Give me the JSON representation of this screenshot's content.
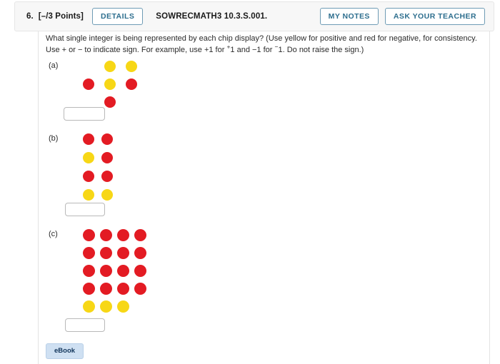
{
  "header": {
    "question_number": "6.",
    "points": "[–/3 Points]",
    "details_label": "DETAILS",
    "title": "SOWRECMATH3 10.3.S.001.",
    "my_notes_label": "MY NOTES",
    "ask_teacher_label": "ASK YOUR TEACHER"
  },
  "prompt": {
    "line1_a": "What single integer is being represented by each chip display? (Use yellow for positive and red for negative, for consistency. Use ",
    "line2_a": "+ or − to indicate sign. For example, use +1 for ",
    "sup1": "+",
    "line2_b": "1 and −1 for ",
    "sup2": "−",
    "line2_c": "1. Do not raise the sign.)"
  },
  "colors": {
    "yellow_chip": "#f7d716",
    "red_chip": "#e31b23",
    "accent": "#2d6e8e",
    "ebook_bg": "#cfe0f2"
  },
  "parts": [
    {
      "label": "(a)",
      "answer_value": "",
      "answer_placeholder": "",
      "rows": [
        [
          "none",
          "yellow",
          "yellow",
          "none"
        ],
        [
          "red",
          "yellow",
          "red",
          "none"
        ],
        [
          "none",
          "red",
          "none",
          "none"
        ]
      ]
    },
    {
      "label": "(b)",
      "answer_value": "",
      "answer_placeholder": "",
      "rows": [
        [
          "red",
          "red"
        ],
        [
          "yellow",
          "red"
        ],
        [
          "red",
          "red"
        ],
        [
          "yellow",
          "yellow"
        ]
      ]
    },
    {
      "label": "(c)",
      "answer_value": "",
      "answer_placeholder": "",
      "rows": [
        [
          "red",
          "red",
          "red",
          "red"
        ],
        [
          "red",
          "red",
          "red",
          "red"
        ],
        [
          "red",
          "red",
          "red",
          "red"
        ],
        [
          "red",
          "red",
          "red",
          "red"
        ],
        [
          "yellow",
          "yellow",
          "yellow",
          "none"
        ]
      ]
    }
  ],
  "footer": {
    "ebook_label": "eBook"
  }
}
